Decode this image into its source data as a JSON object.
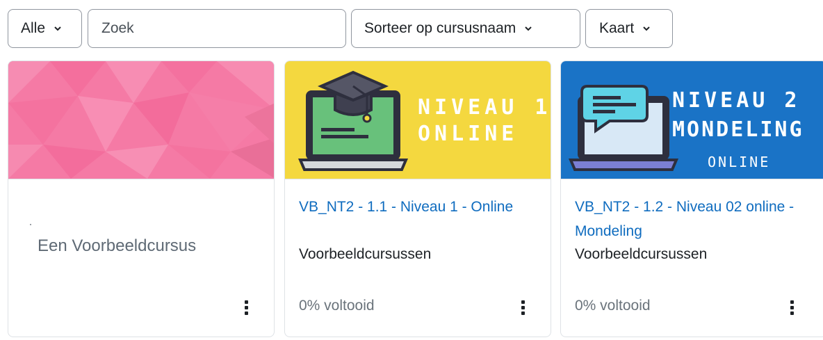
{
  "toolbar": {
    "filter_label": "Alle",
    "search_placeholder": "Zoek",
    "sort_label": "Sorteer op cursusnaam",
    "view_label": "Kaart"
  },
  "courses": [
    {
      "title": "Een Voorbeeldcursus",
      "image_color": "#f57aa5"
    },
    {
      "title": "VB_NT2 - 1.1 - Niveau 1 - Online",
      "category": "Voorbeeldcursussen",
      "progress": "0% voltooid",
      "progress_value": 0,
      "image_text_1": "NIVEAU 1",
      "image_text_2": "ONLINE",
      "image_color": "#f4d83f"
    },
    {
      "title": "VB_NT2 - 1.2 - Niveau 02 online - Mondeling",
      "category": "Voorbeeldcursussen",
      "progress": "0% voltooid",
      "progress_value": 0,
      "image_text_1": "NIVEAU 2",
      "image_text_2": "MONDELING",
      "image_text_3": "ONLINE",
      "image_color": "#1a73c6"
    }
  ],
  "colors": {
    "link": "#0f6cbf",
    "border": "#dee2e6",
    "muted_text": "#6a737b"
  }
}
